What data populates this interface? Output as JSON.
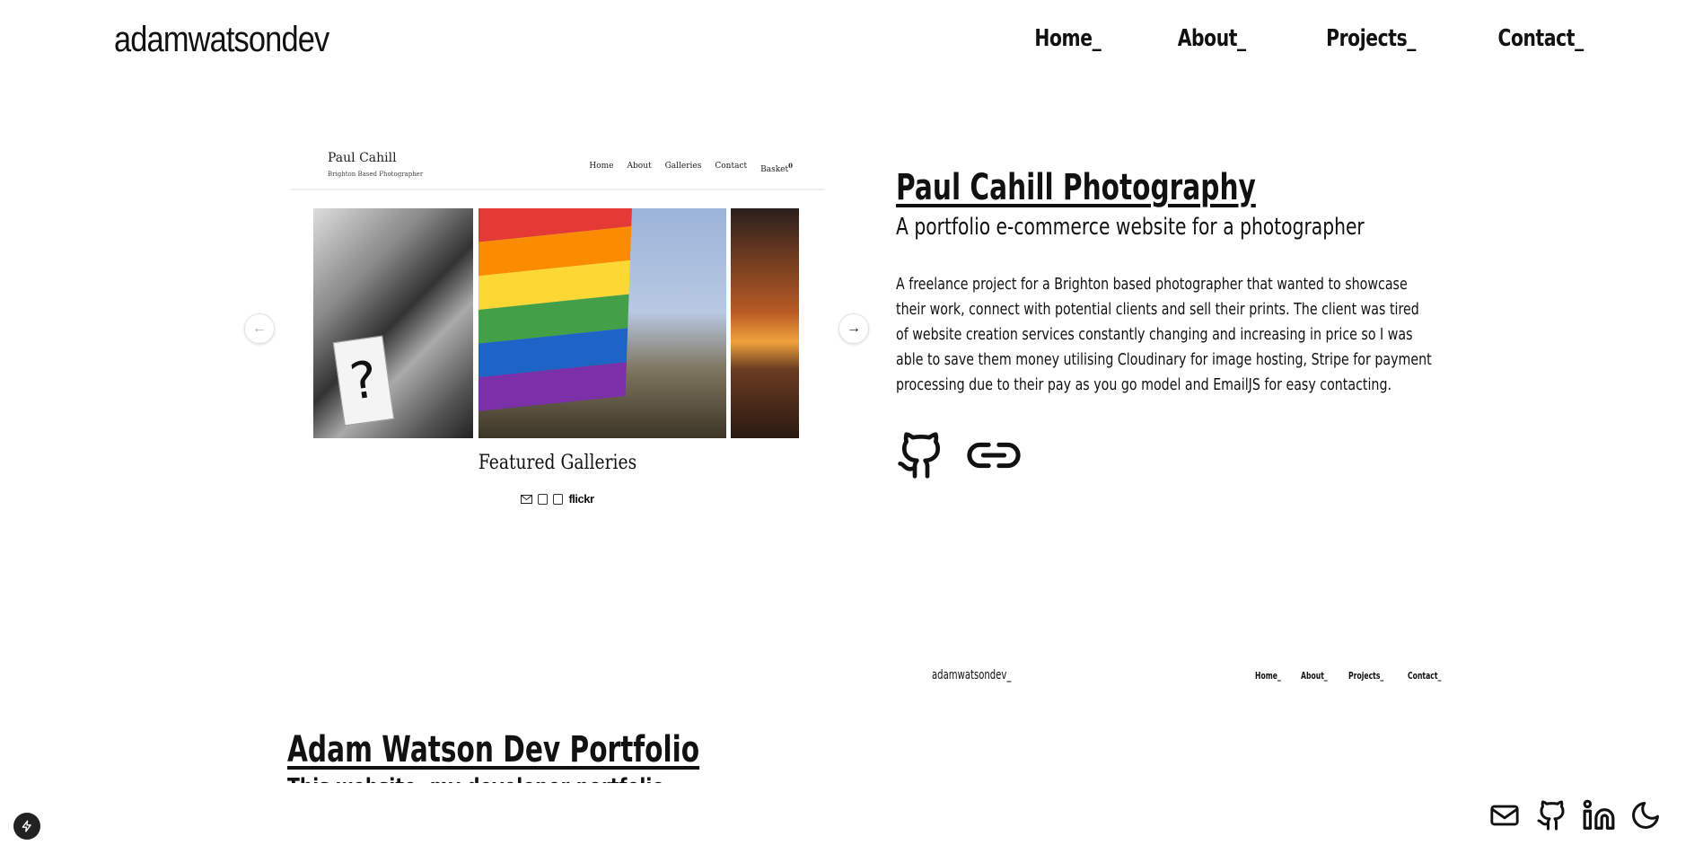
{
  "header": {
    "logo": "adamwatsondev",
    "nav": [
      "Home_",
      "About_",
      "Projects_",
      "Contact_"
    ]
  },
  "carousel": {
    "screenshot": {
      "name": "Paul Cahill",
      "subtitle": "Brighton Based Photographer",
      "nav": [
        "Home",
        "About",
        "Galleries",
        "Contact",
        "Basket"
      ],
      "basket_count": "0",
      "caption": "Featured Galleries",
      "social_text": "flickr"
    },
    "prev_icon": "arrow-left-icon",
    "next_icon": "arrow-right-icon"
  },
  "project": {
    "title": "Paul Cahill Photography",
    "subtitle": "A portfolio e-commerce website for a photographer",
    "description": "A freelance project for a Brighton based photographer that wanted to showcase their work, connect with potential clients and sell their prints. The client was tired of website creation services constantly changing and increasing in price so I was able to save them money utilising Cloudinary for image hosting, Stripe for payment processing due to their pay as you go model and EmailJS for easy contacting.",
    "links": [
      "github-icon",
      "link-icon"
    ]
  },
  "project2": {
    "preview_logo": "adamwatsondev_",
    "preview_nav": [
      "Home_",
      "About_",
      "Projects_",
      "Contact_"
    ],
    "title": "Adam Watson Dev Portfolio",
    "subtitle": "This website, my developer portfolio"
  },
  "footer": {
    "icons": [
      "mail-icon",
      "github-icon",
      "linkedin-icon",
      "moon-icon"
    ]
  }
}
